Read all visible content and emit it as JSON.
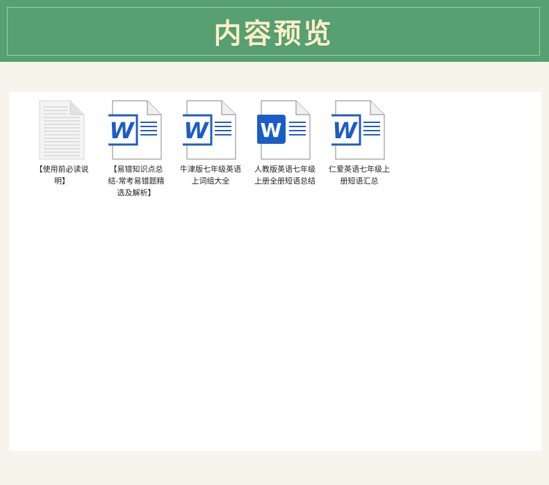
{
  "header": {
    "title": "内容预览"
  },
  "files": [
    {
      "name": "【使用前必读说明】",
      "icon": "text-document-icon"
    },
    {
      "name": "【易错知识点总结-常考易错题精选及解析】",
      "icon": "word-document-icon"
    },
    {
      "name": "牛津版七年级英语上词组大全",
      "icon": "word-document-icon"
    },
    {
      "name": "人教版英语七年级上册全册短语总结",
      "icon": "word-document-icon"
    },
    {
      "name": "仁爱英语七年级上册短语汇总",
      "icon": "word-document-icon"
    }
  ],
  "colors": {
    "header_bg": "#56a072",
    "title": "#fbefc7",
    "page_bg": "#f7f4ec",
    "word_blue": "#1f5bc6"
  }
}
